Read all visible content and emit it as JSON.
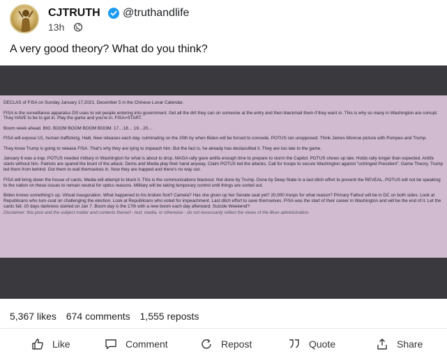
{
  "post": {
    "username": "CJTRUTH",
    "handle": "@truthandlife",
    "time": "13h",
    "text": "A very good theory? What do you think?"
  },
  "note": {
    "paragraphs": [
      "DECLAS of FISA on Sunday January 17,2021. December 5 in the Chinese Lunar Calendar.",
      "FISA is the surveillance apparatus DS uses to vet people entering into government. Get all the dirt they can on someone at the entry and then blackmail them if they want in. This is why so many in Washington are corrupt. They HAVE to be to get in. Play the game and you're in. FISA=START.",
      "Boom week ahead. BIG. BOOM BOOM BOOM BOOM. 17…18… 19…20…",
      "FISA will expose U1, human trafficking, Haiti. New releases each day, culminating on the 20th by when Biden will be forced to concede. POTUS ran unopposed. Think James Monroe picture with Pompeo and Trump.",
      "They know Trump is going to release FISA. That's why they are tying to impeach him. But the fact is, he already has declassified it. They are too late to the game.",
      "January 6 was a trap. POTUS needed military in Washington for what is about to drop. MAGA rally gave antifa enough time to prepare to storm the Capitol. POTUS shows up late. Holds rally longer than expected. Antifa starts without him. Patriots are spared the brunt of the attack. Dems and Media play their hand anyway. Claim POTUS led the attacks. Call for troops to secure Washington against \"unhinged President\". Game Theory. Trump led them from behind. Got them to wall themselves in. Now they are trapped and there's no way out.",
      "FISA will bring down the house of cards. Media will attempt to block it. This is the communications blackout. Not done by Trump. Done by Deep State in a last ditch effort to prevent the REVEAL. POTUS will not be speaking to the nation on these issues to remain neutral for optics reasons. Military will be taking temporary control until things are sorted out.",
      "Biden knows something's up. Virtual inauguration. What happened to his broken foot? Camela? Has she given up her Senate seat yet? 20,000 troops for what reason? Primary Fallout will be in DC on both sides. Look at Republicans who turn-coat on challenging the election. Look at Republicans who voted for impeachment. Last ditch effort to save themselves. FISA was the start of their career in Washington and will be the end of it. Let the cards fall. 10 days darkness started on Jan 7. Boom day is the 17th with a new boom each day afterward. Suicide Weekend?"
    ],
    "disclaimer": "Disclaimer: this post and the subject matter and contents thereof - text, media, or otherwise - do not necessarily reflect the views of the 8kun administration."
  },
  "stats": {
    "likes": "5,367 likes",
    "comments": "674 comments",
    "reposts": "1,555 reposts"
  },
  "actions": {
    "like": "Like",
    "comment": "Comment",
    "repost": "Repost",
    "quote": "Quote",
    "share": "Share"
  },
  "colors": {
    "note_background": "#d0bbd1",
    "image_frame": "#3a3a3e",
    "verified": "#1d9bf0"
  },
  "icons": {
    "verified": "verified-badge-icon",
    "globe": "globe-icon",
    "like": "thumbs-up-icon",
    "comment": "comment-bubble-icon",
    "repost": "repost-icon",
    "quote": "quote-icon",
    "share": "share-icon"
  }
}
